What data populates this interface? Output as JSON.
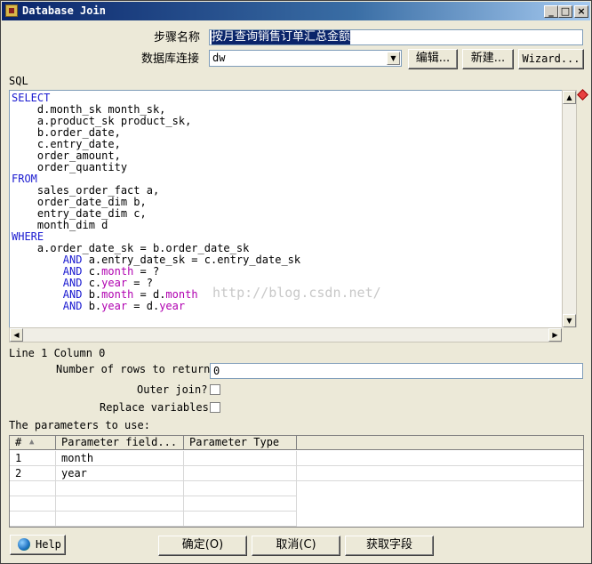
{
  "window": {
    "title": "Database Join",
    "min_label": "_",
    "max_label": "□",
    "close_label": "×"
  },
  "step_name": {
    "label": "步骤名称",
    "value": "按月查询销售订单汇总金额"
  },
  "connection": {
    "label": "数据库连接",
    "value": "dw",
    "edit_label": "编辑...",
    "new_label": "新建...",
    "wizard_label": "Wizard..."
  },
  "sql": {
    "label": "SQL",
    "lines": [
      [
        {
          "t": "SELECT",
          "c": "kw"
        }
      ],
      [
        {
          "t": "    d.month_sk month_sk,",
          "c": ""
        }
      ],
      [
        {
          "t": "    a.product_sk product_sk,",
          "c": ""
        }
      ],
      [
        {
          "t": "    b.order_date,",
          "c": ""
        }
      ],
      [
        {
          "t": "    c.entry_date,",
          "c": ""
        }
      ],
      [
        {
          "t": "    order_amount,",
          "c": ""
        }
      ],
      [
        {
          "t": "    order_quantity",
          "c": ""
        }
      ],
      [
        {
          "t": "FROM",
          "c": "kw"
        }
      ],
      [
        {
          "t": "    sales_order_fact a,",
          "c": ""
        }
      ],
      [
        {
          "t": "    order_date_dim b,",
          "c": ""
        }
      ],
      [
        {
          "t": "    entry_date_dim c,",
          "c": ""
        }
      ],
      [
        {
          "t": "    month_dim d",
          "c": ""
        }
      ],
      [
        {
          "t": "WHERE",
          "c": "kw"
        }
      ],
      [
        {
          "t": "    a.order_date_sk = b.order_date_sk",
          "c": ""
        }
      ],
      [
        {
          "t": "        ",
          "c": ""
        },
        {
          "t": "AND",
          "c": "kw"
        },
        {
          "t": " a.entry_date_sk = c.entry_date_sk",
          "c": ""
        }
      ],
      [
        {
          "t": "        ",
          "c": ""
        },
        {
          "t": "AND",
          "c": "kw"
        },
        {
          "t": " c.",
          "c": ""
        },
        {
          "t": "month",
          "c": "fn"
        },
        {
          "t": " = ?",
          "c": ""
        }
      ],
      [
        {
          "t": "        ",
          "c": ""
        },
        {
          "t": "AND",
          "c": "kw"
        },
        {
          "t": " c.",
          "c": ""
        },
        {
          "t": "year",
          "c": "fn"
        },
        {
          "t": " = ?",
          "c": ""
        }
      ],
      [
        {
          "t": "        ",
          "c": ""
        },
        {
          "t": "AND",
          "c": "kw"
        },
        {
          "t": " b.",
          "c": ""
        },
        {
          "t": "month",
          "c": "fn"
        },
        {
          "t": " = d.",
          "c": ""
        },
        {
          "t": "month",
          "c": "fn"
        }
      ],
      [
        {
          "t": "        ",
          "c": ""
        },
        {
          "t": "AND",
          "c": "kw"
        },
        {
          "t": " b.",
          "c": ""
        },
        {
          "t": "year",
          "c": "fn"
        },
        {
          "t": " = d.",
          "c": ""
        },
        {
          "t": "year",
          "c": "fn"
        }
      ]
    ],
    "watermark": "http://blog.csdn.net/"
  },
  "status": {
    "position": "Line 1 Column 0"
  },
  "rows": {
    "label": "Number of rows to return",
    "value": "0"
  },
  "outer_join": {
    "label": "Outer join?",
    "checked": false
  },
  "replace_vars": {
    "label": "Replace variables",
    "checked": false
  },
  "params": {
    "label": "The parameters to use:",
    "columns": [
      "#",
      "Parameter field...",
      "Parameter Type"
    ],
    "rows": [
      {
        "num": "1",
        "field": "month",
        "type": ""
      },
      {
        "num": "2",
        "field": "year",
        "type": ""
      }
    ]
  },
  "buttons": {
    "help": "Help",
    "ok": "确定(O)",
    "cancel": "取消(C)",
    "get_fields": "获取字段"
  }
}
